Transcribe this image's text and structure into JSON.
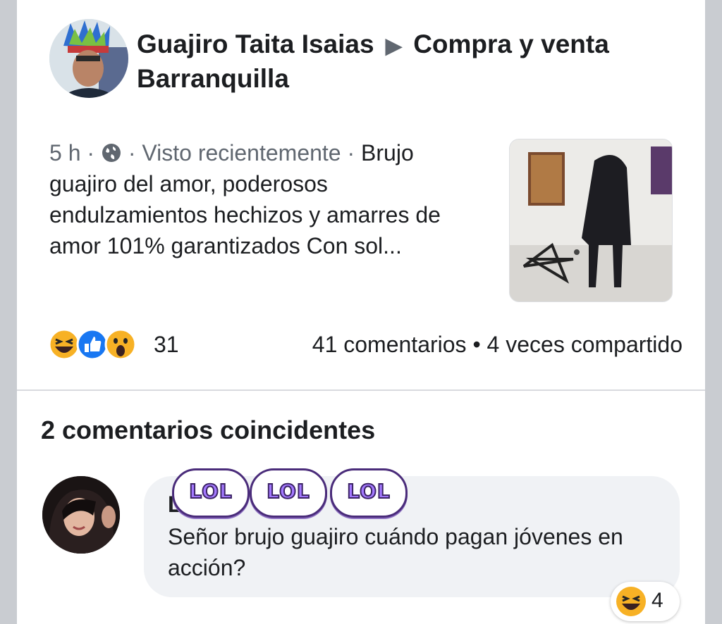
{
  "post": {
    "author": "Guajiro Taita Isaias",
    "group": "Compra y venta Barranquilla",
    "time": "5 h",
    "seen": "Visto recientemente",
    "text": "Brujo guajiro del amor, poderosos endulzamientos hechizos y amarres de amor 101% garantizados  Con sol...",
    "reaction_count": "31",
    "comments_count": "41 comentarios",
    "shares": "4 veces compartido",
    "reactions": [
      "laugh-icon",
      "like-icon",
      "wow-icon"
    ]
  },
  "comments_section": {
    "title": "2 comentarios coincidentes"
  },
  "comment": {
    "author_partial": "L      ua   n",
    "text": "Señor brujo guajiro cuándo pagan jóvenes en acción?",
    "reaction_count": "4",
    "reaction_icon": "laugh-icon"
  },
  "stickers": [
    "LOL",
    "LOL",
    "LOL"
  ],
  "colors": {
    "card": "#ffffff",
    "background": "#c9ccd1",
    "meta_text": "#606770",
    "bubble": "#f0f2f5",
    "like_blue": "#1877f2",
    "emoji_yellow": "#f7b125",
    "sticker_purple": "#a479ff"
  }
}
